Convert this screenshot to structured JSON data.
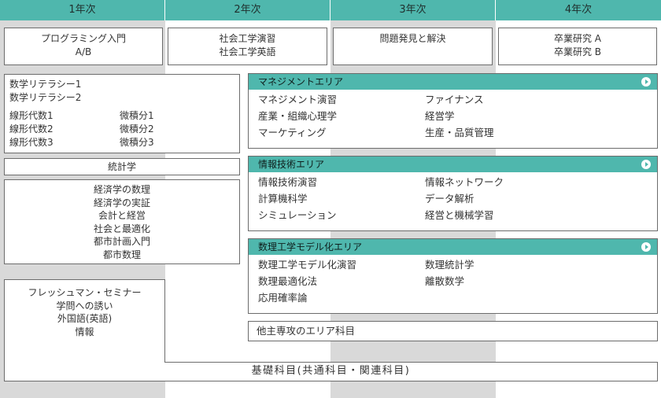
{
  "columns": [
    "1年次",
    "2年次",
    "3年次",
    "4年次"
  ],
  "year1": {
    "programming": [
      "プログラミング入門",
      "A/B"
    ],
    "math_literacy": [
      "数学リテラシー1",
      "数学リテラシー2"
    ],
    "linear_algebra": [
      "線形代数1",
      "線形代数2",
      "線形代数3"
    ],
    "calculus": [
      "微積分1",
      "微積分2",
      "微積分3"
    ],
    "statistics": "統計学",
    "economics": [
      "経済学の数理",
      "経済学の実証",
      "会計と経営",
      "社会と最適化",
      "都市計画入門",
      "都市数理"
    ],
    "freshman": [
      "フレッシュマン・セミナー",
      "学問への誘い",
      "外国語(英語)",
      "情報"
    ]
  },
  "year2": {
    "seminar": [
      "社会工学演習",
      "社会工学英語"
    ]
  },
  "year3": {
    "problem": "問題発見と解決"
  },
  "year4": {
    "graduation": [
      "卒業研究 A",
      "卒業研究 B"
    ]
  },
  "areas": [
    {
      "title": "マネジメントエリア",
      "left": [
        "マネジメント演習",
        "産業・組織心理学",
        "マーケティング"
      ],
      "right": [
        "ファイナンス",
        "経営学",
        "生産・品質管理"
      ]
    },
    {
      "title": "情報技術エリア",
      "left": [
        "情報技術演習",
        "計算機科学",
        "シミュレーション"
      ],
      "right": [
        "情報ネットワーク",
        "データ解析",
        "経営と機械学習"
      ]
    },
    {
      "title": "数理工学モデル化エリア",
      "left": [
        "数理工学モデル化演習",
        "数理最適化法",
        "応用確率論"
      ],
      "right": [
        "数理統計学",
        "離散数学",
        ""
      ]
    }
  ],
  "other_area": "他主専攻のエリア科目",
  "foundation": "基礎科目(共通科目・関連科目)",
  "colors": {
    "header": "#4fb7ad",
    "column_shade": "#d9d9d9",
    "border": "#6c6c6c"
  }
}
